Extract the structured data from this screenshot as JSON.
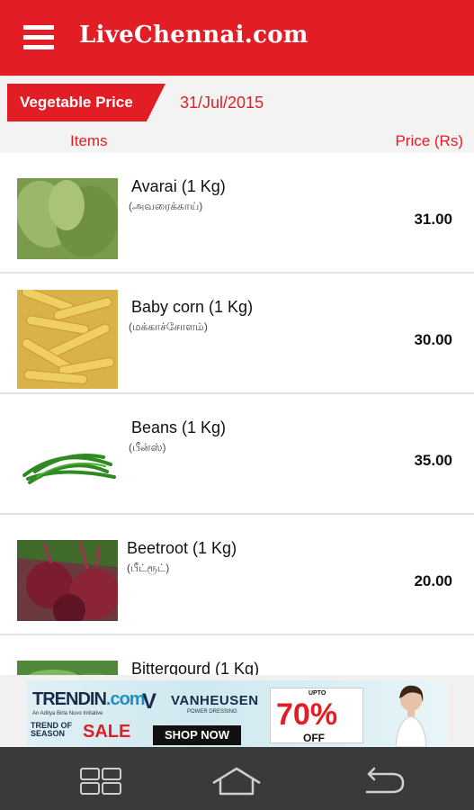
{
  "app": {
    "title": "LiveChennai.com",
    "menu_icon": "hamburger-icon"
  },
  "header": {
    "tag": "Vegetable Price",
    "date": "31/Jul/2015",
    "col_items": "Items",
    "col_price": "Price (Rs)"
  },
  "items": [
    {
      "name": "Avarai (1 Kg)",
      "tamil": "(அவரைக்காய்)",
      "price": "31.00",
      "image": "avarai-photo"
    },
    {
      "name": "Baby corn (1 Kg)",
      "tamil": "(மக்காச்சோளம்)",
      "price": "30.00",
      "image": "babycorn-photo"
    },
    {
      "name": "Beans (1 Kg)",
      "tamil": "(பீன்ஸ்)",
      "price": "35.00",
      "image": "beans-photo"
    },
    {
      "name": "Beetroot (1 Kg)",
      "tamil": "(பீட்ரூட்)",
      "price": "20.00",
      "image": "beetroot-photo"
    },
    {
      "name": "Bittergourd (1 Kg)",
      "tamil": "",
      "price": "",
      "image": "bittergourd-photo"
    }
  ],
  "ad": {
    "brand1": "TRENDIN",
    "brand1_suffix": ".com",
    "brand1_sub": "An Aditya Birla Nuvo Initiative",
    "sale_small": "TREND OF SEASON",
    "sale_big": "SALE",
    "brand2_letter": "V",
    "brand2": "VANHEUSEN",
    "brand2_sub": "POWER DRESSING",
    "shop": "SHOP NOW",
    "upto": "UPTO",
    "discount": "70%",
    "off": "OFF"
  },
  "navbar": {
    "recent": "recent-apps-icon",
    "home": "home-icon",
    "back": "back-icon"
  },
  "colors": {
    "primary": "#e31d25",
    "navbar": "#3a3a3a"
  }
}
